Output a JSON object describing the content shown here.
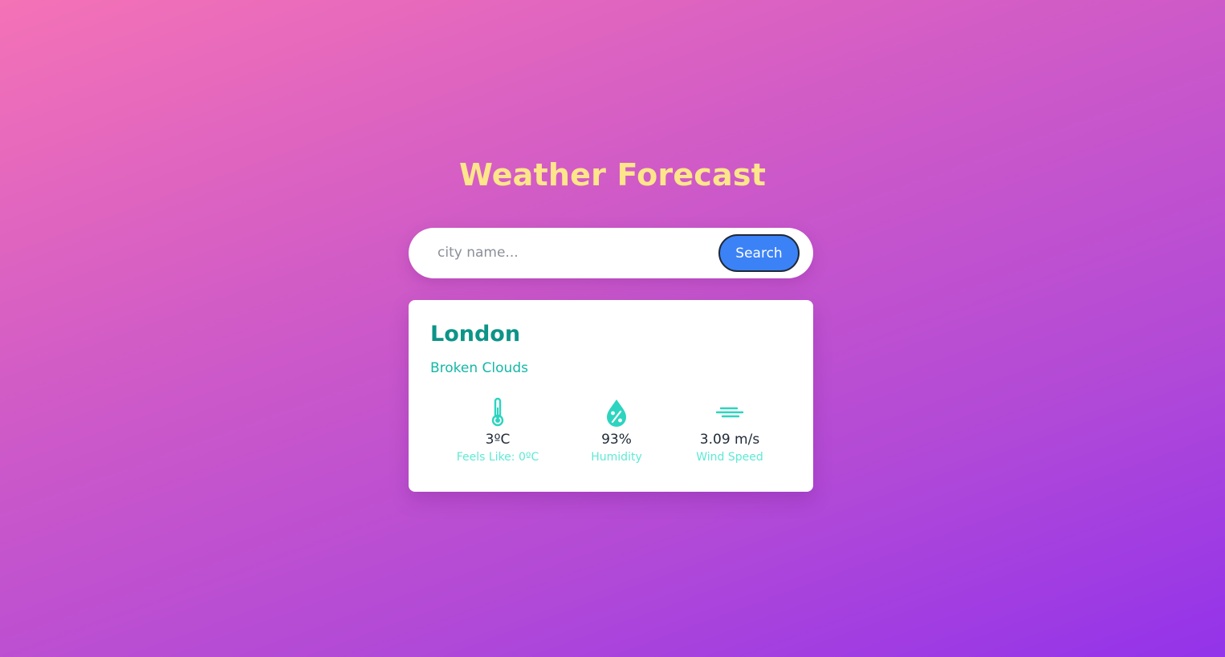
{
  "page": {
    "title": "Weather Forecast"
  },
  "search": {
    "placeholder": "city name...",
    "button_label": "Search"
  },
  "weather": {
    "city": "London",
    "description": "Broken Clouds",
    "temperature": {
      "icon": "thermometer-icon",
      "value": "3ºC",
      "label": "Feels Like: 0ºC"
    },
    "humidity": {
      "icon": "humidity-drop-icon",
      "value": "93%",
      "label": "Humidity"
    },
    "wind": {
      "icon": "wind-icon",
      "value": "3.09 m/s",
      "label": "Wind Speed"
    }
  },
  "colors": {
    "title": "#fde68a",
    "accent_dark": "#0d9488",
    "accent": "#14b8a6",
    "accent_light": "#5eead4",
    "button": "#3b82f6"
  }
}
